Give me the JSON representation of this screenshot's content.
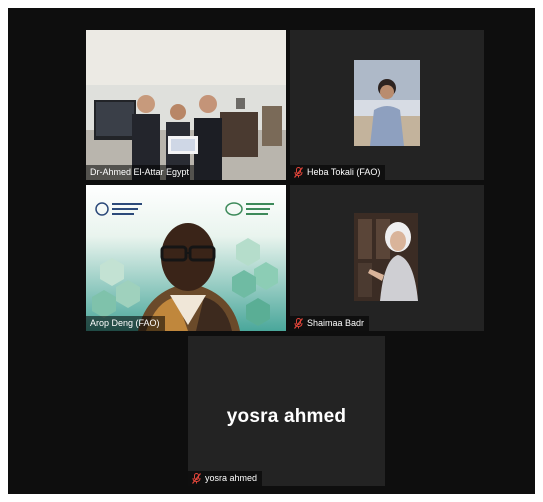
{
  "participants": [
    {
      "name": "Dr-Ahmed El-Attar Egypt",
      "muted": false,
      "active": true
    },
    {
      "name": "Heba Tokali (FAO)",
      "muted": true,
      "active": false
    },
    {
      "name": "Arop Deng (FAO)",
      "muted": false,
      "active": false
    },
    {
      "name": "Shaimaa Badr",
      "muted": true,
      "active": false
    },
    {
      "name": "yosra ahmed",
      "muted": true,
      "active": false,
      "avatar_text": "yosra ahmed"
    }
  ],
  "colors": {
    "active_speaker_border": "#d3e25d",
    "muted_mic": "#e0453a",
    "background": "#0e0e0e",
    "tile": "#232323"
  },
  "icons": [
    "mic-muted-icon"
  ]
}
